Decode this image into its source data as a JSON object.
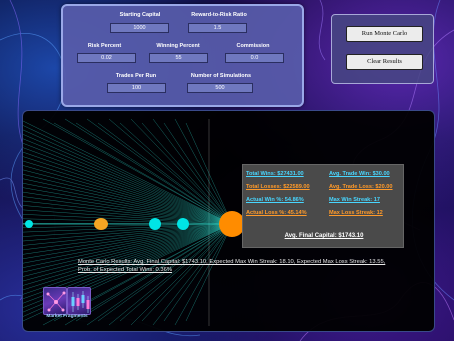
{
  "controls": {
    "starting_capital": {
      "label": "Starting Capital",
      "value": "1000"
    },
    "reward_to_risk": {
      "label": "Reward-to-Risk Ratio",
      "value": "1.5"
    },
    "risk_percent": {
      "label": "Risk Percent",
      "value": "0.02"
    },
    "winning_percent": {
      "label": "Winning Percent",
      "value": "55"
    },
    "commission": {
      "label": "Commission",
      "value": "0.0"
    },
    "trades_per_run": {
      "label": "Trades Per Run",
      "value": "100"
    },
    "num_simulations": {
      "label": "Number of Simulations",
      "value": "500"
    }
  },
  "buttons": {
    "run": "Run Monte Carlo",
    "clear": "Clear Results"
  },
  "stats": {
    "total_wins": "Total Wins: $27431.00",
    "avg_trade_win": "Avg. Trade Win: $30.00",
    "total_losses": "Total Losses: $22589.00",
    "avg_trade_loss": "Avg. Trade Loss: $20.00",
    "actual_win_pct": "Actual Win %: 54.86%",
    "max_win_streak": "Max Win Streak: 17",
    "actual_loss_pct": "Actual Loss %: 45.14%",
    "max_loss_streak": "Max Loss Streak: 12",
    "avg_final_capital": "Avg. Final Capital: $1743.10"
  },
  "summary": "Monte Carlo Results: Avg. Final Capital: $1743.10, Expected Max Win Streak: 18.10, Expected Max Loss Streak: 13.55, Prob. of Expected Total Wins: 0.36%",
  "logo_text": "Market Fragments",
  "colors": {
    "win_line": "#2fe0d0",
    "node_cyan": "#00e5e5",
    "node_orange": "#f5a623",
    "final_node": "#ff8c00",
    "stat_win": "#48d6ff",
    "stat_loss": "#ff9a2a"
  }
}
